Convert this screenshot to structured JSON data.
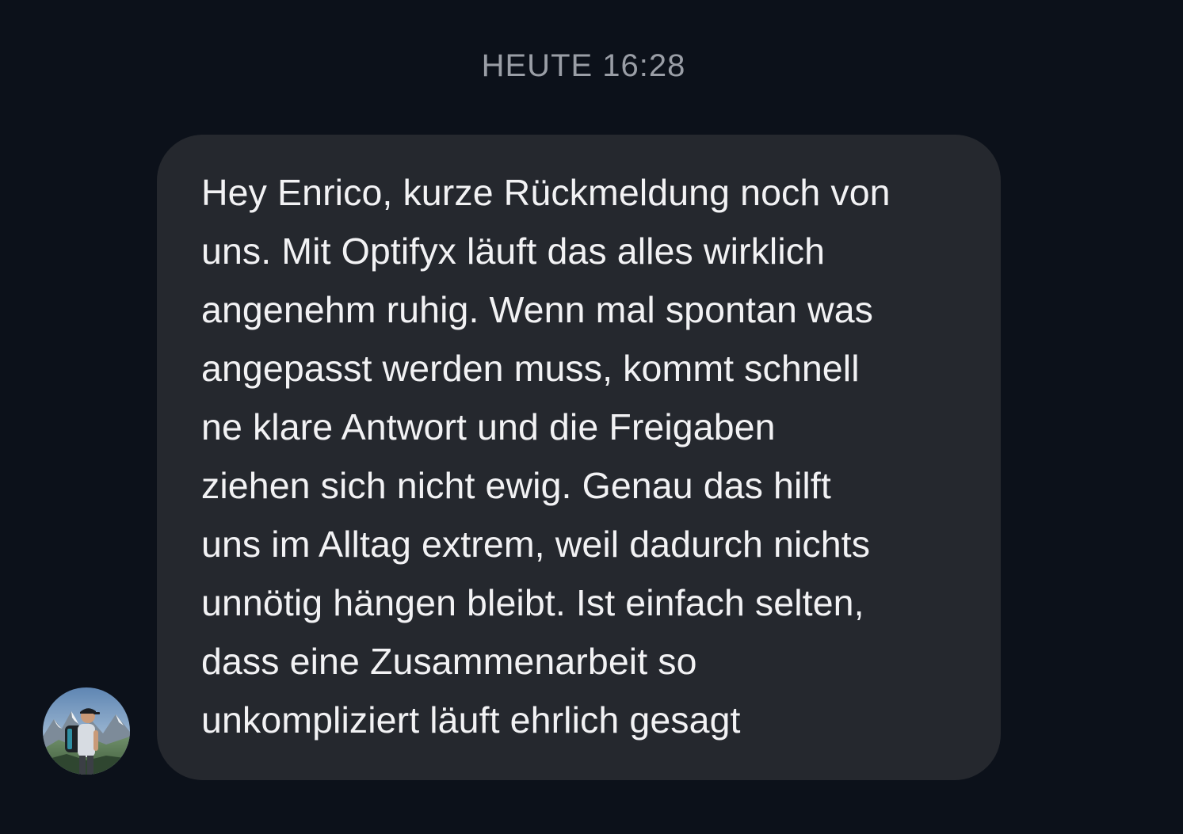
{
  "conversation": {
    "timestamp": "HEUTE 16:28",
    "message": {
      "text": "Hey Enrico, kurze Rückmeldung noch von\nuns. Mit Optifyx läuft das alles wirklich\nangenehm ruhig. Wenn mal spontan was\nangepasst werden muss, kommt schnell\nne klare Antwort und die Freigaben\nziehen sich nicht ewig. Genau das hilft\nuns im Alltag extrem, weil dadurch nichts\nunnötig hängen bleibt. Ist einfach selten,\ndass eine Zusammenarbeit so\nunkompliziert läuft ehrlich gesagt",
      "bubble_color": "#25282e",
      "text_color": "#f2f2f4"
    },
    "sender": {
      "avatar_icon": "hiker-mountain-avatar-icon"
    }
  },
  "theme": {
    "background": "#0c111a",
    "timestamp_color": "#9a9ea6"
  }
}
